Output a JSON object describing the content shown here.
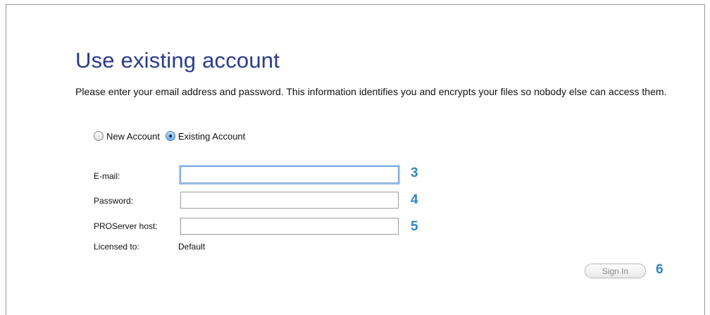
{
  "dialog": {
    "title": "Use existing account",
    "description": "Please enter your email address and password. This information identifies you and encrypts your files so nobody else can access them."
  },
  "account_type": {
    "options": [
      {
        "label": "New Account",
        "selected": false
      },
      {
        "label": "Existing Account",
        "selected": true
      }
    ]
  },
  "form": {
    "email": {
      "label": "E-mail:",
      "value": "",
      "step": "3"
    },
    "password": {
      "label": "Password:",
      "value": "",
      "step": "4"
    },
    "proserver_host": {
      "label": "PROServer host:",
      "value": "",
      "step": "5"
    },
    "licensed_to": {
      "label": "Licensed to:",
      "value": "Default"
    }
  },
  "sign_in": {
    "label": "Sign In",
    "step": "6"
  },
  "colors": {
    "title": "#2a3c8e",
    "step_number": "#2f86c0",
    "focus_ring": "#a8c8ee"
  }
}
